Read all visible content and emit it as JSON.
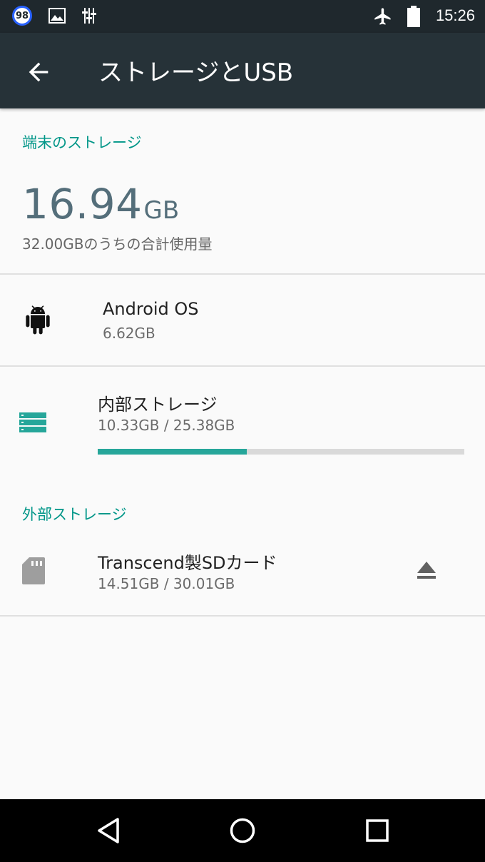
{
  "status_bar": {
    "badge": "98",
    "time": "15:26",
    "icons": [
      "notification-badge-icon",
      "image-icon",
      "equalizer-icon",
      "airplane-mode-icon",
      "battery-icon"
    ]
  },
  "toolbar": {
    "back_icon": "arrow-back-icon",
    "title": "ストレージとUSB"
  },
  "device_storage": {
    "header": "端末のストレージ",
    "used_value": "16.94",
    "used_unit": "GB",
    "summary": "32.00GBのうちの合計使用量"
  },
  "items": [
    {
      "icon": "android-icon",
      "title": "Android OS",
      "subtitle": "6.62GB"
    },
    {
      "icon": "storage-icon",
      "title": "内部ストレージ",
      "subtitle": "10.33GB / 25.38GB",
      "progress": 0.407
    }
  ],
  "external_storage": {
    "header": "外部ストレージ",
    "item": {
      "icon": "sd-card-icon",
      "title": "Transcend製SDカード",
      "subtitle": "14.51GB / 30.01GB",
      "action_icon": "eject-icon"
    }
  },
  "colors": {
    "accent": "#009688",
    "toolbar": "#263238",
    "status_bar": "#1f282d",
    "progress": "#26a69a"
  },
  "nav_bar": {
    "icons": [
      "back-triangle-icon",
      "home-circle-icon",
      "recents-square-icon"
    ]
  }
}
